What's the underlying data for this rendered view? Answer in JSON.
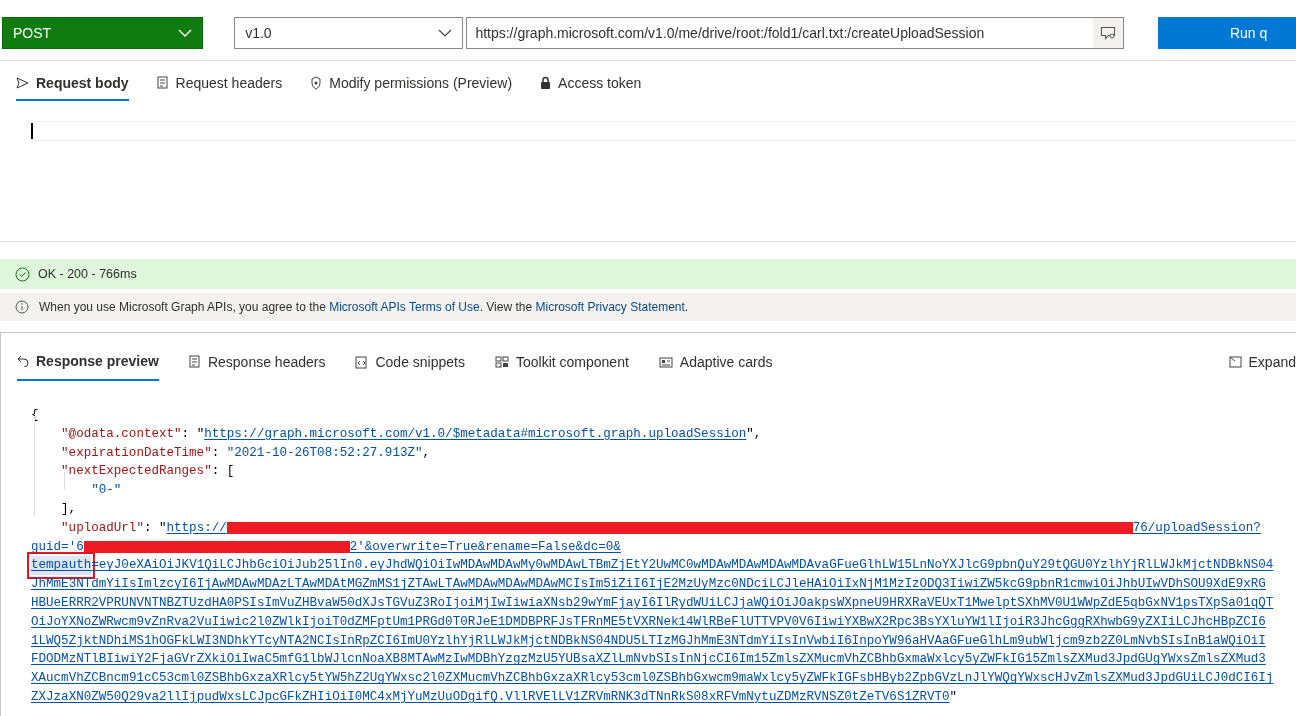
{
  "query_bar": {
    "method": "POST",
    "version": "v1.0",
    "url": "https://graph.microsoft.com/v1.0/me/drive/root:/fold1/carl.txt:/createUploadSession",
    "run_button": "Run q"
  },
  "request_tabs": [
    {
      "label": "Request body",
      "selected": true
    },
    {
      "label": "Request headers",
      "selected": false
    },
    {
      "label": "Modify permissions (Preview)",
      "selected": false
    },
    {
      "label": "Access token",
      "selected": false
    }
  ],
  "status": {
    "kind": "success",
    "text": "OK - 200 - 766ms"
  },
  "notice": [
    {
      "kind": "text",
      "text": "When you use Microsoft Graph APIs, you agree to the "
    },
    {
      "kind": "link",
      "text": "Microsoft APIs Terms of Use"
    },
    {
      "kind": "text",
      "text": ". View the "
    },
    {
      "kind": "link",
      "text": "Microsoft Privacy Statement"
    },
    {
      "kind": "text",
      "text": "."
    }
  ],
  "response_tabs": [
    {
      "label": "Response preview",
      "selected": true
    },
    {
      "label": "Response headers",
      "selected": false
    },
    {
      "label": "Code snippets",
      "selected": false
    },
    {
      "label": "Toolkit component",
      "selected": false
    },
    {
      "label": "Adaptive cards",
      "selected": false
    }
  ],
  "expand_button": "Expand",
  "response_lines": [
    [
      {
        "kind": "punct",
        "text": "{"
      }
    ],
    [
      {
        "kind": "indent"
      },
      {
        "kind": "key",
        "text": "\"@odata.context\""
      },
      {
        "kind": "punct",
        "text": ": \""
      },
      {
        "kind": "link",
        "text": "https://graph.microsoft.com/v1.0/$metadata#microsoft.graph.uploadSession"
      },
      {
        "kind": "punct",
        "text": "\","
      }
    ],
    [
      {
        "kind": "indent"
      },
      {
        "kind": "key",
        "text": "\"expirationDateTime\""
      },
      {
        "kind": "punct",
        "text": ": "
      },
      {
        "kind": "string",
        "text": "\"2021-10-26T08:52:27.913Z\""
      },
      {
        "kind": "punct",
        "text": ","
      }
    ],
    [
      {
        "kind": "indent"
      },
      {
        "kind": "key",
        "text": "\"nextExpectedRanges\""
      },
      {
        "kind": "punct",
        "text": ": ["
      }
    ],
    [
      {
        "kind": "indent"
      },
      {
        "kind": "indent"
      },
      {
        "kind": "string",
        "text": "\"0-\""
      }
    ],
    [
      {
        "kind": "indent"
      },
      {
        "kind": "punct",
        "text": "],"
      }
    ],
    [
      {
        "kind": "indent"
      },
      {
        "kind": "key",
        "text": "\"uploadUrl\""
      },
      {
        "kind": "punct",
        "text": ": \""
      },
      {
        "kind": "link",
        "text": "https://"
      },
      {
        "kind": "redacted"
      },
      {
        "kind": "link",
        "text": "76/uploadSession?"
      }
    ],
    [
      {
        "kind": "link",
        "text": "guid='6"
      },
      {
        "kind": "redacted"
      },
      {
        "kind": "link",
        "text": "2'&overwrite=True&rename=False&dc=0&"
      }
    ],
    [
      {
        "kind": "boxed",
        "text": "tempauth"
      },
      {
        "kind": "link",
        "text": "=eyJ0eXAiOiJKV1QiLCJhbGciOiJub25lIn0.eyJhdWQiOiIwMDAwMDAwMy0wMDAwLTBmZjEtY2UwMC0wMDAwMDAwMDAwMDAvaGFueGlhLW15LnNoYXJlcG9pbnQuY29tQGU0YzlhYjRlLWJkMjctNDBkNS04"
      }
    ],
    [
      {
        "kind": "link",
        "text": "JhMmE3NTdmYiIsImlzcyI6IjAwMDAwMDAzLTAwMDAtMGZmMS1jZTAwLTAwMDAwMDAwMDAwMCIsIm5iZiI6IjE2MzUyMzc0NDciLCJleHAiOiIxNjM1MzIzODQ3IiwiZW5kcG9pbnR1cmwiOiJhbUIwVDhSOU9XdE9xRG"
      }
    ],
    [
      {
        "kind": "link",
        "text": "HBUeERRR2VPRUNVNTNBZTUzdHA0PSIsImVuZHBvaW50dXJsTGVuZ3RoIjoiMjIwIiwiaXNsb29wYmFjayI6IlRydWUiLCJjaWQiOiJOakpsWXpneU9HRXRaVEUxT1MwelptSXhMV0U1WWpZdE5qbGxNV1psTXpSa01qQT"
      }
    ],
    [
      {
        "kind": "link",
        "text": "OiJoYXNoZWRwcm9vZnRva2VuIiwic2l0ZWlkIjoiT0dZMFptUm1PRGd0T0RJeE1DMDBPRFJsTFRnME5tVXRNek14WlRBeFlUTTVPV0V6IiwiYXBwX2Rpc3BsYXluYW1lIjoiR3JhcGggRXhwbG9yZXIiLCJhcHBpZCI6"
      }
    ],
    [
      {
        "kind": "link",
        "text": "1LWQ5ZjktNDhiMS1hOGFkLWI3NDhkYTcyNTA2NCIsInRpZCI6ImU0YzlhYjRlLWJkMjctNDBkNS04NDU5LTIzMGJhMmE3NTdmYiIsInVwbiI6InpoYW96aHVAaGFueGlhLm9ubWljcm9zb2Z0LmNvbSIsInB1aWQiOiI"
      }
    ],
    [
      {
        "kind": "link",
        "text": "FDODMzNTlBIiwiY2FjaGVrZXkiOiIwaC5mfG1lbWJlcnNoaXB8MTAwMzIwMDBhYzgzMzU5YUBsaXZlLmNvbSIsInNjcCI6Im15ZmlsZXMucmVhZCBhbGxmaWxlcy5yZWFkIG15ZmlsZXMud3JpdGUgYWxsZmlsZXMud3"
      }
    ],
    [
      {
        "kind": "link",
        "text": "XAucmVhZCBncm91cC53cml0ZSBhbGxzaXRlcy5tYW5hZ2UgYWxsc2l0ZXMucmVhZCBhbGxzaXRlcy53cml0ZSBhbGxwcm9maWxlcy5yZWFkIGFsbHByb2ZpbGVzLnJlYWQgYWxscHJvZmlsZXMud3JpdGUiLCJ0dCI6Ij"
      }
    ],
    [
      {
        "kind": "link",
        "text": "ZXJzaXN0ZW50Q29va2llIjpudWxsLCJpcGFkZHIiOiI0MC4xMjYuMzUuODgifQ.VllRVElLV1ZRVmRNK3dTNnRkS08xRFVmNytuZDMzRVNSZ0tZeTV6S1ZRVT0"
      },
      {
        "kind": "punct",
        "text": "\""
      }
    ]
  ]
}
